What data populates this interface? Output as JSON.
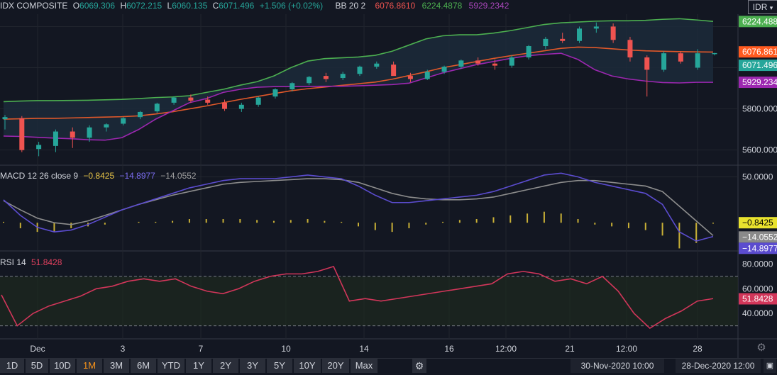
{
  "header": {
    "symbol": "IDX COMPOSITE",
    "o_label": "O",
    "o_value": "6069.306",
    "h_label": "H",
    "h_value": "6072.215",
    "l_label": "L",
    "l_value": "6060.135",
    "c_label": "C",
    "c_value": "6071.496",
    "change": "+1.506 (+0.02%)",
    "bb_label": "BB 20 2",
    "bb_mid": "6076.8610",
    "bb_upper": "6224.4878",
    "bb_lower": "5929.2342",
    "currency": "IDR",
    "currency_icon": "chevron-down-icon"
  },
  "macd_header": {
    "label": "MACD 12 26 close 9",
    "hist": "−0.8425",
    "macd": "−14.8977",
    "signal": "−14.0552"
  },
  "rsi_header": {
    "label": "RSI 14",
    "value": "51.8428"
  },
  "colors": {
    "bg": "#131722",
    "up": "#26a69a",
    "down": "#ef5350",
    "bb_upper": "#4caf50",
    "bb_mid": "#e0582a",
    "bb_lower": "#9c27b0",
    "macd": "#5b4ccf",
    "signal": "#8d8d8d",
    "hist": "#c9b036",
    "rsi": "#d2365a"
  },
  "price_axis": {
    "ticks": [
      "5600.000",
      "5800.000"
    ],
    "tags": {
      "upper": "6224.488",
      "mid": "6076.861",
      "close": "6071.496",
      "lower": "5929.234"
    }
  },
  "macd_axis": {
    "ticks": [
      "50.0000"
    ],
    "tags": {
      "hist": "−0.8425",
      "signal": "−14.0552",
      "macd": "−14.8977"
    }
  },
  "rsi_axis": {
    "ticks": [
      "80.0000",
      "60.0000",
      "40.0000"
    ],
    "tag": "51.8428"
  },
  "x_axis": {
    "ticks": [
      "Dec",
      "3",
      "7",
      "10",
      "14",
      "16",
      "12:00",
      "21",
      "12:00",
      "28"
    ]
  },
  "timeframes": [
    "1D",
    "5D",
    "10D",
    "1M",
    "3M",
    "6M",
    "YTD",
    "1Y",
    "2Y",
    "3Y",
    "5Y",
    "10Y",
    "20Y",
    "Max"
  ],
  "active_timeframe": "1M",
  "settings_icon": "gear-icon",
  "range_start": "30-Nov-2020 10:00",
  "range_end": "28-Dec-2020 12:00",
  "range_icon": "calendar-icon",
  "chart_data": [
    {
      "type": "candlestick",
      "title": "IDX COMPOSITE",
      "ylim": [
        5530,
        6260
      ],
      "series": [
        {
          "name": "BB upper",
          "values": [
            5835,
            5838,
            5840,
            5840,
            5841,
            5842,
            5844,
            5846,
            5850,
            5855,
            5858,
            5864,
            5880,
            5895,
            5915,
            5932,
            5960,
            6000,
            6032,
            6044,
            6048,
            6052,
            6060,
            6080,
            6110,
            6140,
            6155,
            6160,
            6160,
            6168,
            6180,
            6195,
            6210,
            6218,
            6222,
            6226,
            6228,
            6228,
            6230,
            6235,
            6238,
            6232,
            6225
          ]
        },
        {
          "name": "BB mid",
          "values": [
            5750,
            5752,
            5754,
            5754,
            5756,
            5758,
            5760,
            5762,
            5766,
            5775,
            5786,
            5800,
            5814,
            5830,
            5846,
            5860,
            5874,
            5888,
            5898,
            5906,
            5914,
            5922,
            5930,
            5944,
            5962,
            5980,
            6000,
            6015,
            6030,
            6045,
            6058,
            6070,
            6082,
            6094,
            6100,
            6098,
            6092,
            6086,
            6082,
            6080,
            6078,
            6077,
            6076
          ]
        },
        {
          "name": "BB lower",
          "values": [
            5668,
            5666,
            5662,
            5658,
            5655,
            5650,
            5648,
            5660,
            5700,
            5750,
            5790,
            5830,
            5850,
            5880,
            5895,
            5905,
            5908,
            5908,
            5909,
            5910,
            5910,
            5912,
            5915,
            5918,
            5925,
            5950,
            5975,
            5995,
            6015,
            6030,
            6045,
            6058,
            6065,
            6070,
            6040,
            5990,
            5960,
            5945,
            5935,
            5928,
            5926,
            5929,
            5929
          ]
        }
      ],
      "candles": [
        {
          "o": 5750,
          "h": 5770,
          "l": 5700,
          "c": 5760
        },
        {
          "o": 5755,
          "h": 5765,
          "l": 5590,
          "c": 5600
        },
        {
          "o": 5605,
          "h": 5640,
          "l": 5570,
          "c": 5625
        },
        {
          "o": 5620,
          "h": 5700,
          "l": 5590,
          "c": 5690
        },
        {
          "o": 5690,
          "h": 5710,
          "l": 5610,
          "c": 5660
        },
        {
          "o": 5660,
          "h": 5720,
          "l": 5640,
          "c": 5710
        },
        {
          "o": 5710,
          "h": 5730,
          "l": 5690,
          "c": 5725
        },
        {
          "o": 5728,
          "h": 5760,
          "l": 5720,
          "c": 5755
        },
        {
          "o": 5760,
          "h": 5790,
          "l": 5750,
          "c": 5785
        },
        {
          "o": 5788,
          "h": 5830,
          "l": 5780,
          "c": 5825
        },
        {
          "o": 5830,
          "h": 5860,
          "l": 5820,
          "c": 5855
        },
        {
          "o": 5855,
          "h": 5870,
          "l": 5830,
          "c": 5840
        },
        {
          "o": 5845,
          "h": 5860,
          "l": 5820,
          "c": 5830
        },
        {
          "o": 5830,
          "h": 5845,
          "l": 5790,
          "c": 5800
        },
        {
          "o": 5800,
          "h": 5830,
          "l": 5785,
          "c": 5820
        },
        {
          "o": 5820,
          "h": 5860,
          "l": 5810,
          "c": 5855
        },
        {
          "o": 5860,
          "h": 5900,
          "l": 5850,
          "c": 5895
        },
        {
          "o": 5895,
          "h": 5930,
          "l": 5885,
          "c": 5925
        },
        {
          "o": 5925,
          "h": 5960,
          "l": 5915,
          "c": 5955
        },
        {
          "o": 5960,
          "h": 5975,
          "l": 5930,
          "c": 5945
        },
        {
          "o": 5950,
          "h": 5980,
          "l": 5940,
          "c": 5970
        },
        {
          "o": 5970,
          "h": 6010,
          "l": 5960,
          "c": 6005
        },
        {
          "o": 6005,
          "h": 6030,
          "l": 5995,
          "c": 6020
        },
        {
          "o": 6015,
          "h": 6030,
          "l": 5990,
          "c": 5960
        },
        {
          "o": 5960,
          "h": 5975,
          "l": 5930,
          "c": 5945
        },
        {
          "o": 5945,
          "h": 5990,
          "l": 5940,
          "c": 5980
        },
        {
          "o": 5980,
          "h": 6010,
          "l": 5970,
          "c": 6005
        },
        {
          "o": 6005,
          "h": 6040,
          "l": 5995,
          "c": 6035
        },
        {
          "o": 6035,
          "h": 6050,
          "l": 6010,
          "c": 6020
        },
        {
          "o": 6020,
          "h": 6040,
          "l": 5990,
          "c": 6010
        },
        {
          "o": 6010,
          "h": 6060,
          "l": 6000,
          "c": 6050
        },
        {
          "o": 6050,
          "h": 6110,
          "l": 6040,
          "c": 6105
        },
        {
          "o": 6105,
          "h": 6150,
          "l": 6090,
          "c": 6140
        },
        {
          "o": 6140,
          "h": 6170,
          "l": 6120,
          "c": 6130
        },
        {
          "o": 6130,
          "h": 6200,
          "l": 6120,
          "c": 6190
        },
        {
          "o": 6190,
          "h": 6220,
          "l": 6170,
          "c": 6200
        },
        {
          "o": 6200,
          "h": 6215,
          "l": 6120,
          "c": 6135
        },
        {
          "o": 6135,
          "h": 6150,
          "l": 6030,
          "c": 6050
        },
        {
          "o": 6050,
          "h": 6060,
          "l": 5860,
          "c": 5990
        },
        {
          "o": 5990,
          "h": 6080,
          "l": 5980,
          "c": 6070
        },
        {
          "o": 6070,
          "h": 6080,
          "l": 6020,
          "c": 6030
        },
        {
          "o": 6000,
          "h": 6090,
          "l": 5990,
          "c": 6070
        },
        {
          "o": 6069,
          "h": 6072,
          "l": 6060,
          "c": 6071
        }
      ]
    },
    {
      "type": "line",
      "title": "MACD 12 26 close 9",
      "ylim": [
        -30,
        62
      ],
      "series": [
        {
          "name": "MACD",
          "values": [
            25,
            8,
            -5,
            -10,
            -8,
            -2,
            6,
            14,
            20,
            26,
            32,
            38,
            42,
            46,
            48,
            48,
            48,
            50,
            52,
            50,
            48,
            40,
            30,
            22,
            22,
            24,
            26,
            28,
            30,
            34,
            40,
            46,
            52,
            54,
            50,
            44,
            40,
            36,
            32,
            20,
            -10,
            -20,
            -15
          ]
        },
        {
          "name": "signal",
          "values": [
            24,
            14,
            5,
            0,
            -2,
            2,
            8,
            14,
            20,
            25,
            30,
            34,
            38,
            42,
            44,
            45,
            46,
            47,
            48,
            48,
            47,
            44,
            38,
            32,
            28,
            26,
            25,
            25,
            26,
            28,
            32,
            36,
            40,
            44,
            46,
            46,
            44,
            42,
            40,
            34,
            18,
            2,
            -14
          ]
        }
      ],
      "histogram": [
        1,
        -6,
        -10,
        -10,
        -6,
        -4,
        -2,
        0,
        1,
        1,
        2,
        4,
        4,
        4,
        4,
        3,
        2,
        3,
        4,
        2,
        1,
        -4,
        -8,
        -10,
        -6,
        -2,
        1,
        3,
        4,
        6,
        8,
        10,
        12,
        10,
        4,
        -2,
        -4,
        -6,
        -8,
        -14,
        -28,
        -22,
        -1
      ]
    },
    {
      "type": "line",
      "title": "RSI 14",
      "ylim": [
        20,
        90
      ],
      "series": [
        {
          "name": "RSI",
          "values": [
            55,
            30,
            40,
            46,
            50,
            54,
            60,
            62,
            66,
            68,
            66,
            68,
            62,
            58,
            56,
            60,
            66,
            70,
            72,
            72,
            74,
            78,
            50,
            52,
            50,
            52,
            54,
            56,
            58,
            60,
            62,
            64,
            72,
            74,
            72,
            66,
            68,
            64,
            70,
            58,
            40,
            28,
            36,
            42,
            50,
            52
          ]
        }
      ],
      "guides": [
        70,
        30
      ]
    }
  ]
}
